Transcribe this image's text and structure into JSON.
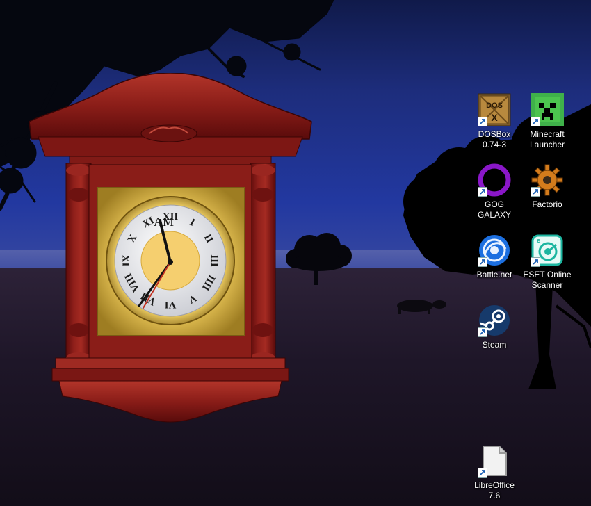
{
  "clock": {
    "am_pm": "AM",
    "numerals": [
      "XII",
      "I",
      "II",
      "III",
      "IIII",
      "V",
      "VI",
      "VII",
      "VIII",
      "IX",
      "X",
      "XI"
    ]
  },
  "icons": [
    {
      "id": "dosbox",
      "label": "DOSBox 0.74-3",
      "icon": "dosbox-icon"
    },
    {
      "id": "minecraft",
      "label": "Minecraft Launcher",
      "icon": "minecraft-icon"
    },
    {
      "id": "gog",
      "label": "GOG GALAXY",
      "icon": "gog-galaxy-icon"
    },
    {
      "id": "factorio",
      "label": "Factorio",
      "icon": "factorio-gear-icon"
    },
    {
      "id": "battlenet",
      "label": "Battle.net",
      "icon": "battlenet-icon"
    },
    {
      "id": "eset",
      "label": "ESET Online Scanner",
      "icon": "eset-scanner-icon"
    },
    {
      "id": "steam",
      "label": "Steam",
      "icon": "steam-icon"
    },
    {
      "id": "libreoffice",
      "label": "LibreOffice 7.6",
      "icon": "libreoffice-icon"
    }
  ],
  "dosbox_letters": "DOS",
  "dosbox_x": "X"
}
